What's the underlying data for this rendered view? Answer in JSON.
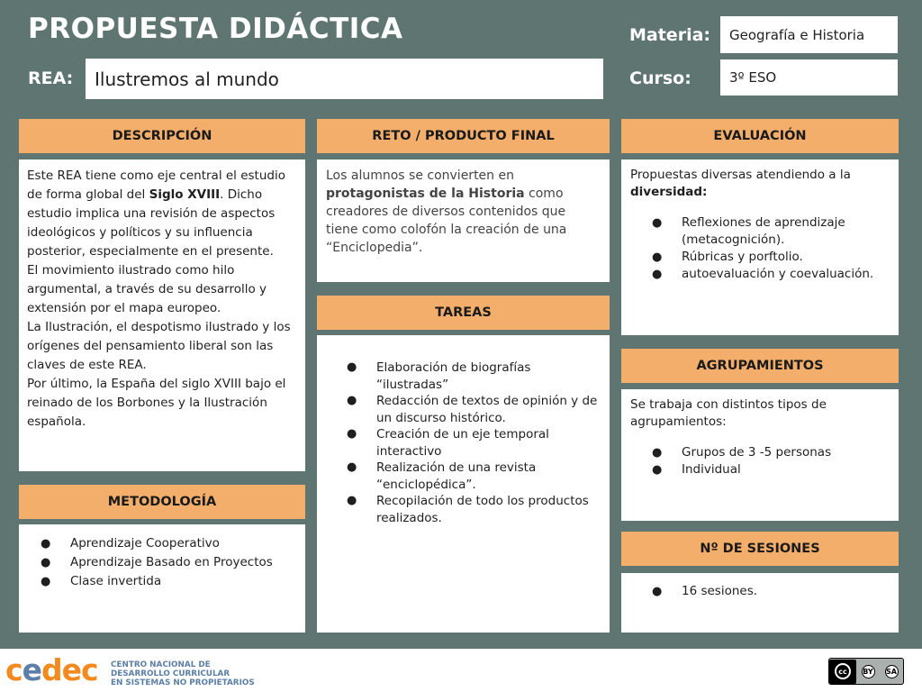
{
  "header": {
    "title": "PROPUESTA DIDÁCTICA",
    "rea_label": "REA:",
    "rea_value": "Ilustremos al mundo",
    "materia_label": "Materia:",
    "materia_value": "Geografía e Historia",
    "curso_label": "Curso:",
    "curso_value": "3º ESO"
  },
  "descripcion": {
    "heading": "DESCRIPCIÓN",
    "p1_before": "Este REA  tiene como eje central el estudio de forma global del ",
    "p1_strong": "Siglo XVIII",
    "p1_after": ". Dicho estudio implica una revisión de aspectos ideológicos y políticos y su influencia posterior, especialmente en el presente.",
    "p2": "El movimiento ilustrado como hilo argumental, a través de su desarrollo y extensión por  el mapa europeo.",
    "p3": "La Ilustración, el despotismo ilustrado y los orígenes del pensamiento liberal son las claves de este REA.",
    "p4": "Por último, la España del siglo XVIII bajo el reinado de los Borbones y la Ilustración española."
  },
  "reto": {
    "heading": "RETO / PRODUCTO FINAL",
    "before": "Los alumnos se convierten en ",
    "strong": "protagonistas de la Historia",
    "after": " como creadores de diversos contenidos que tiene como colofón la creación de una “Enciclopedia”."
  },
  "evaluacion": {
    "heading": "EVALUACIÓN",
    "intro_before": "Propuestas diversas atendiendo a la ",
    "intro_strong": "diversidad:",
    "items": [
      "Reflexiones de aprendizaje (metacognición).",
      "Rúbricas y porftolio.",
      "autoevaluación y coevaluación."
    ]
  },
  "tareas": {
    "heading": "TAREAS",
    "items": [
      "Elaboración de biografías “ilustradas”",
      "Redacción de textos de opinión y de un discurso histórico.",
      "Creación de un eje temporal interactivo",
      "Realización de una revista “enciclopédica”.",
      "Recopilación de todo los productos realizados."
    ]
  },
  "agrupamientos": {
    "heading": "AGRUPAMIENTOS",
    "intro": "Se trabaja con distintos tipos de agrupamientos:",
    "items": [
      "Grupos de 3 -5 personas",
      "Individual"
    ]
  },
  "metodologia": {
    "heading": "METODOLOGÍA",
    "items": [
      "Aprendizaje Cooperativo",
      "Aprendizaje Basado en Proyectos",
      "Clase invertida"
    ]
  },
  "sesiones": {
    "heading": "Nº DE SESIONES",
    "items": [
      "16 sesiones."
    ]
  },
  "footer": {
    "logo_c": "c",
    "logo_e": "e",
    "logo_dec": "dec",
    "org_line1": "CENTRO NACIONAL DE",
    "org_line2": "DESARROLLO CURRICULAR",
    "org_line3": "EN SISTEMAS NO PROPIETARIOS",
    "cc_main": "cc",
    "cc_by": "BY",
    "cc_sa": "SA"
  },
  "bullet": "●"
}
